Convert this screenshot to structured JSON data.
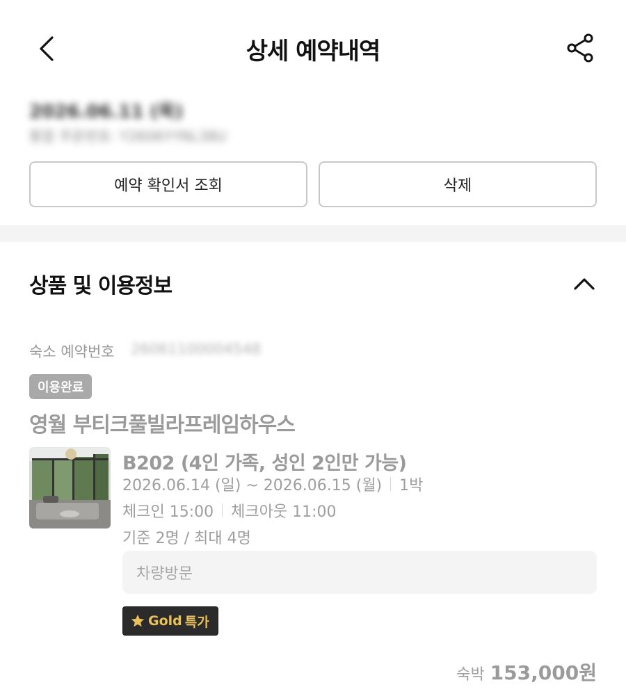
{
  "header": {
    "title": "상세 예약내역",
    "back_icon": "chevron-left-icon",
    "share_icon": "share-icon"
  },
  "order": {
    "date": "2026.06.11 (목)",
    "number": "통합 주문번호: Y2606YYNL38U"
  },
  "actions": {
    "confirm_label": "예약 확인서 조회",
    "delete_label": "삭제"
  },
  "section": {
    "title": "상품 및 이용정보",
    "collapse_icon": "chevron-up-icon"
  },
  "reservation": {
    "label": "숙소 예약번호",
    "number": "26061100004548",
    "status": "이용완료",
    "property_name": "영월 부티크풀빌라프레임하우스",
    "room_name": "B202 (4인 가족, 성인 2인만 가능)",
    "date_range": "2026.06.14 (일) ~ 2026.06.15 (월)",
    "nights": "1박",
    "check_in": "체크인 15:00",
    "check_out": "체크아웃 11:00",
    "capacity": "기준 2명 / 최대 4명",
    "vehicle": "차량방문",
    "badge": {
      "gold": "Gold",
      "special": "특가"
    },
    "price_label": "숙박",
    "price": "153,000원"
  },
  "colors": {
    "gold": "#e8c15a",
    "badge_bg": "#2b2b2b",
    "status_bg": "#a9a9a9"
  }
}
